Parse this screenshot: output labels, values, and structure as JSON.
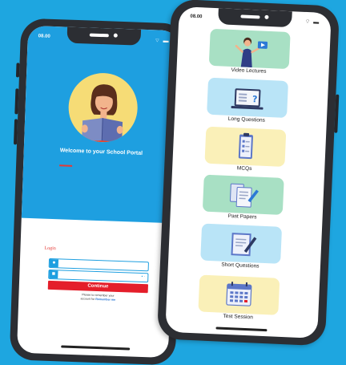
{
  "login_screen": {
    "status_time": "08.00",
    "status_icons": "wifi-battery",
    "welcome_text": "Welcome to your School Portal",
    "login_title": "Login",
    "username_value": "",
    "password_value": "",
    "password_toggle": "• ·",
    "continue_label": "Continue",
    "footer_text": "Please to remember your",
    "footer_text_2": "account for",
    "footer_link": "Remember me",
    "colors": {
      "primary": "#1e9fe0",
      "accent": "#e41e2a",
      "avatar_bg": "#f6dc76"
    }
  },
  "menu_screen": {
    "status_time": "08.00",
    "status_icons": "wifi-battery",
    "items": [
      {
        "label": "Video Lectures",
        "icon": "video-lecture-icon",
        "color": "#a8e0c4"
      },
      {
        "label": "Long Questions",
        "icon": "long-questions-icon",
        "color": "#b9e4f7"
      },
      {
        "label": "MCQs",
        "icon": "mcqs-icon",
        "color": "#faf0b8"
      },
      {
        "label": "Past Papers",
        "icon": "past-papers-icon",
        "color": "#a8e0c4"
      },
      {
        "label": "Short Questions",
        "icon": "short-questions-icon",
        "color": "#b9e4f7"
      },
      {
        "label": "Test Session",
        "icon": "test-session-icon",
        "color": "#faf0b8"
      }
    ]
  }
}
